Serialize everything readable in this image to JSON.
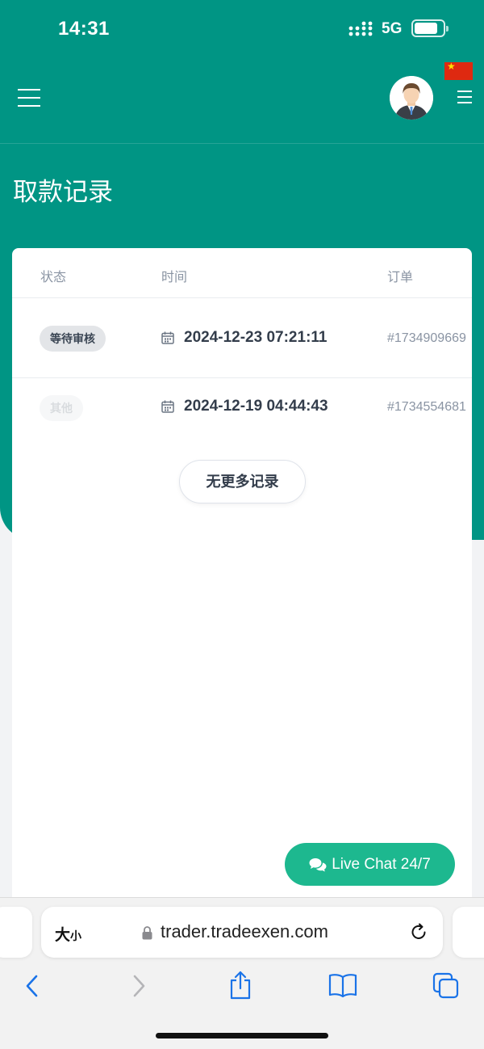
{
  "status_bar": {
    "time": "14:31",
    "network": "5G"
  },
  "header": {
    "title": "取款记录"
  },
  "table": {
    "columns": [
      "状态",
      "时间",
      "订单"
    ],
    "rows": [
      {
        "status": "等待审核",
        "time": "2024-12-23 07:21:11",
        "order": "#1734909669"
      },
      {
        "status": "其他",
        "time": "2024-12-19 04:44:43",
        "order": "#1734554681"
      }
    ],
    "no_more_label": "无更多记录"
  },
  "live_chat": {
    "label": "Live Chat 24/7"
  },
  "browser": {
    "text_size_big": "大",
    "text_size_small": "小",
    "url": "trader.tradeexen.com"
  },
  "colors": {
    "brand": "#009584",
    "chat": "#1db88f"
  }
}
